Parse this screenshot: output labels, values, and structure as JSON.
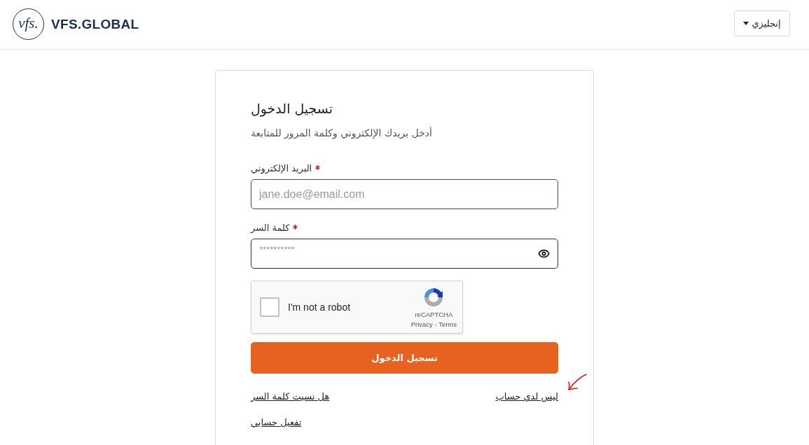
{
  "header": {
    "logo": {
      "mark": "vfs.",
      "wordmark": "VFS.GLOBAL"
    },
    "language_menu": {
      "label": "إنجليزي"
    }
  },
  "login_card": {
    "title": "تسجيل الدخول",
    "subtitle": "أدخل بريدك الإلكتروني وكلمة المرور للمتابعة",
    "fields": [
      {
        "kind": "email",
        "label": "البريد الإلكتروني",
        "required": true,
        "placeholder": "jane.doe@email.com"
      },
      {
        "kind": "password",
        "label": "كلمة السر",
        "required": true,
        "placeholder": "**********"
      }
    ],
    "captcha": {
      "label": "I'm not a robot",
      "checked": false,
      "brand": "reCAPTCHA",
      "links": "Privacy - Terms"
    },
    "submit": {
      "label": "تسجيل الدخول"
    },
    "links": [
      {
        "label": "ليس لدي حساب"
      },
      {
        "label": "هل نسيت كلمة السر"
      },
      {
        "label": "تفعيل حسابي"
      }
    ]
  }
}
